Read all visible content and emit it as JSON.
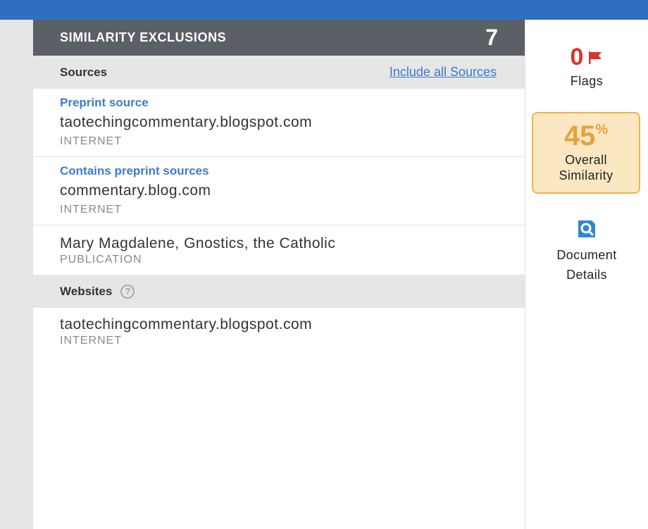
{
  "panel": {
    "title": "SIMILARITY EXCLUSIONS",
    "count": "7"
  },
  "sources": {
    "label": "Sources",
    "link": "Include all Sources",
    "items": [
      {
        "tag": "Preprint source",
        "name": "taotechingcommentary.blogspot.com",
        "kind": "INTERNET"
      },
      {
        "tag": "Contains preprint sources",
        "name": "commentary.blog.com",
        "kind": "INTERNET"
      },
      {
        "name": "Mary Magdalene, Gnostics, the Catholic",
        "kind": "PUBLICATION"
      }
    ]
  },
  "websites": {
    "label": "Websites",
    "help_icon": "question-circle-icon",
    "items": [
      {
        "name": "taotechingcommentary.blogspot.com",
        "kind": "INTERNET"
      }
    ]
  },
  "side": {
    "flags_count": "0",
    "flags_label": "Flags",
    "flag_icon": "flag-icon",
    "similarity_value": "45",
    "similarity_unit": "%",
    "similarity_label_1": "Overall",
    "similarity_label_2": "Similarity",
    "doc_icon": "search-document-icon",
    "doc_label_1": "Document",
    "doc_label_2": "Details"
  },
  "colors": {
    "topbar": "#2f6fc2",
    "header": "#5b5f66",
    "link": "#3b7cc9",
    "flag": "#d9342b",
    "similarity": "#e8a23b"
  }
}
